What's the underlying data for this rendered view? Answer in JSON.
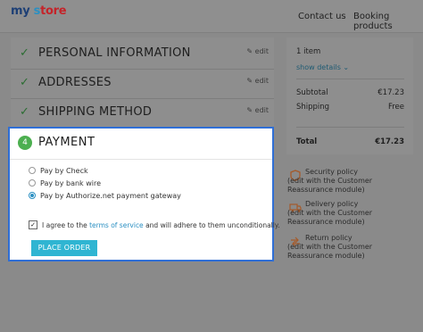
{
  "header": {
    "logo": [
      "my",
      " ",
      "s",
      "tore"
    ],
    "nav": [
      "Contact us",
      "Booking products"
    ]
  },
  "steps": [
    {
      "title": "PERSONAL INFORMATION",
      "edit": "edit"
    },
    {
      "title": "ADDRESSES",
      "edit": "edit"
    },
    {
      "title": "SHIPPING METHOD",
      "edit": "edit"
    }
  ],
  "payment": {
    "step_number": "4",
    "title": "PAYMENT",
    "options": [
      {
        "label": "Pay by Check",
        "selected": false
      },
      {
        "label": "Pay by bank wire",
        "selected": false
      },
      {
        "label": "Pay by Authorize.net payment gateway",
        "selected": true
      }
    ],
    "agree_before": "I agree to the ",
    "agree_link": "terms of service",
    "agree_after": " and will adhere to them unconditionally.",
    "agree_checked": true,
    "place_order": "PLACE ORDER"
  },
  "summary": {
    "items": "1 item",
    "show_details": "show details",
    "subtotal_label": "Subtotal",
    "subtotal": "€17.23",
    "shipping_label": "Shipping",
    "shipping": "Free",
    "total_label": "Total",
    "total": "€17.23"
  },
  "reassurance": [
    {
      "title": "Security policy",
      "sub": "(edit with the Customer Reassurance module)"
    },
    {
      "title": "Delivery policy",
      "sub": "(edit with the Customer Reassurance module)"
    },
    {
      "title": "Return policy",
      "sub": "(edit with the Customer Reassurance module)"
    }
  ],
  "colors": {
    "accent": "#2fb5d2",
    "panel_border": "#2f6fd6",
    "step_done": "#4caf50"
  }
}
